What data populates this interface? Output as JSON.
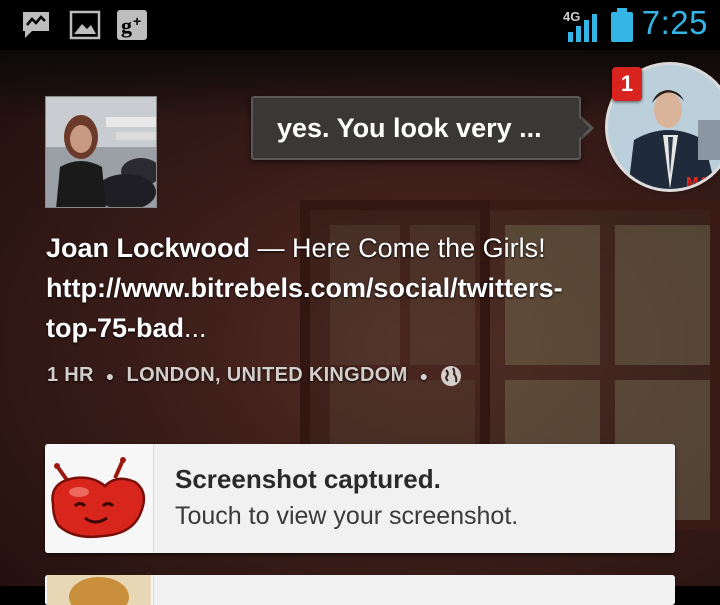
{
  "status_bar": {
    "network": "4G",
    "time": "7:25",
    "notification_icons": [
      "talk-icon",
      "gallery-icon",
      "google-plus-icon"
    ],
    "colors": {
      "accent": "#33b5e5"
    }
  },
  "chathead": {
    "message_preview": "yes. You look very ...",
    "unread_count": "1",
    "poster_text": "MAD"
  },
  "post": {
    "author": "Joan Lockwood",
    "separator": " — ",
    "body_line1": "Here Come the Girls!",
    "link_line1": "http://www.bitrebels.com/social/twitters-",
    "link_line2": "top-75-bad",
    "ellipsis": "...",
    "time_ago": "1 HR",
    "location": "LONDON, UNITED KINGDOM",
    "visibility_icon": "globe-icon"
  },
  "notification": {
    "title": "Screenshot captured.",
    "subtitle": "Touch to view your screenshot.",
    "icon": "jelly-bean-icon",
    "colors": {
      "icon": "#d8261c"
    }
  }
}
